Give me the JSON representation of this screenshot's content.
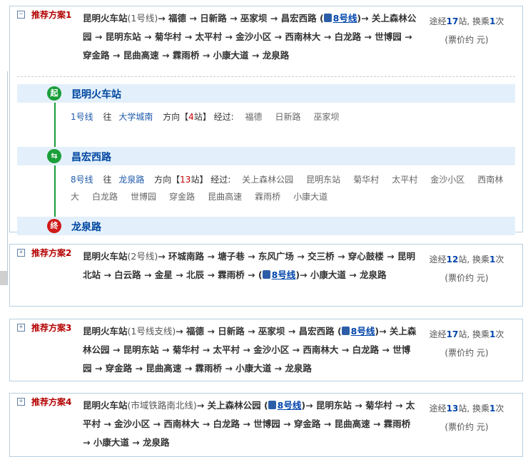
{
  "plans": [
    {
      "title": "推荐方案1",
      "toggle": "−",
      "stats": {
        "prefix": "途经",
        "stations": "17",
        "mid": "站, 换乘",
        "transfers": "1",
        "suffix": "次",
        "price": "(票价约  元)"
      },
      "route_text": [
        {
          "t": "昆明火车站",
          "c": "st"
        },
        {
          "t": "(1号线)",
          "c": "line"
        },
        {
          "t": "→ 福德 → 日新路 → 巫家坝 → 昌宏西路 (",
          "c": "st"
        },
        {
          "t": "8号线",
          "c": "bus"
        },
        {
          "t": ")→ 关上森林公园 → 昆明东站 → 菊华村 → 太平村 → 金沙小区 → 西南林大 → 白龙路 → 世博园 → 穿金路 → 昆曲高速 → 霖雨桥 → 小康大道 → 龙泉路",
          "c": "st"
        }
      ],
      "expanded": {
        "start": {
          "badge": "起",
          "name": "昆明火车站"
        },
        "seg1": {
          "line": "1号线",
          "dir_label": "往",
          "dir": "大学城南",
          "dir2": "方向【",
          "count": "4",
          "count_suffix": "站】 经过:",
          "stops": [
            "福德",
            "日新路",
            "巫家坝"
          ]
        },
        "transfer": {
          "badge": "⇆",
          "name": "昌宏西路"
        },
        "seg2": {
          "line": "8号线",
          "dir_label": "往",
          "dir": "龙泉路",
          "dir2": "方向【",
          "count": "13",
          "count_suffix": "站】 经过:",
          "stops": [
            "关上森林公园",
            "昆明东站",
            "菊华村",
            "太平村",
            "金沙小区",
            "西南林大",
            "白龙路",
            "世博园",
            "穿金路",
            "昆曲高速",
            "霖雨桥",
            "小康大道"
          ]
        },
        "end": {
          "badge": "终",
          "name": "龙泉路"
        }
      }
    },
    {
      "title": "推荐方案2",
      "toggle": "+",
      "stats": {
        "prefix": "途经",
        "stations": "12",
        "mid": "站, 换乘",
        "transfers": "1",
        "suffix": "次",
        "price": "(票价约  元)"
      },
      "route_text": [
        {
          "t": "昆明火车站",
          "c": "st"
        },
        {
          "t": "(2号线)",
          "c": "line"
        },
        {
          "t": "→ 环城南路 → 塘子巷 → 东风广场 → 交三桥 → 穿心鼓楼 → 昆明北站 → 白云路 → 金星 → 北辰 → 霖雨桥 → (",
          "c": "st"
        },
        {
          "t": "8号线",
          "c": "bus"
        },
        {
          "t": ")→ 小康大道 → 龙泉路",
          "c": "st"
        }
      ]
    },
    {
      "title": "推荐方案3",
      "toggle": "+",
      "stats": {
        "prefix": "途经",
        "stations": "17",
        "mid": "站, 换乘",
        "transfers": "1",
        "suffix": "次",
        "price": "(票价约  元)"
      },
      "route_text": [
        {
          "t": "昆明火车站",
          "c": "st"
        },
        {
          "t": "(1号线支线)",
          "c": "line"
        },
        {
          "t": "→ 福德 → 日新路 → 巫家坝 → 昌宏西路 (",
          "c": "st"
        },
        {
          "t": "8号线",
          "c": "bus"
        },
        {
          "t": ")→ 关上森林公园 → 昆明东站 → 菊华村 → 太平村 → 金沙小区 → 西南林大 → 白龙路 → 世博园 → 穿金路 → 昆曲高速 → 霖雨桥 → 小康大道 → 龙泉路",
          "c": "st"
        }
      ]
    },
    {
      "title": "推荐方案4",
      "toggle": "+",
      "stats": {
        "prefix": "途经",
        "stations": "13",
        "mid": "站, 换乘",
        "transfers": "1",
        "suffix": "次",
        "price": "(票价约  元)"
      },
      "route_text": [
        {
          "t": "昆明火车站",
          "c": "st"
        },
        {
          "t": "(市域铁路南北线)",
          "c": "line"
        },
        {
          "t": "→ 关上森林公园 (",
          "c": "st"
        },
        {
          "t": "8号线",
          "c": "bus"
        },
        {
          "t": ")→ 昆明东站 → 菊华村 → 太平村 → 金沙小区 → 西南林大 → 白龙路 → 世博园 → 穿金路 → 昆曲高速 → 霖雨桥 → 小康大道 → 龙泉路",
          "c": "st"
        }
      ]
    }
  ],
  "colors": {
    "start": "#1b9e3a",
    "transfer": "#1b9e3a",
    "end": "#d11a1a"
  }
}
